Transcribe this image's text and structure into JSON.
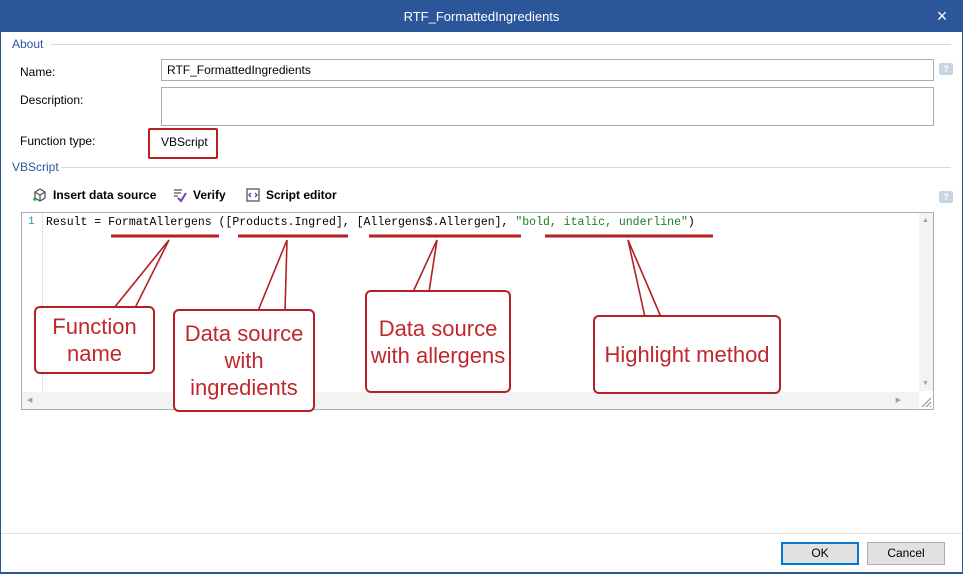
{
  "window": {
    "title": "RTF_FormattedIngredients",
    "close_icon": "×"
  },
  "about": {
    "section_label": "About",
    "name_label": "Name:",
    "name_value": "RTF_FormattedIngredients",
    "description_label": "Description:",
    "description_value": "",
    "function_type_label": "Function type:",
    "function_type_value": "VBScript"
  },
  "vbscript": {
    "section_label": "VBScript",
    "toolbar": {
      "insert_label": "Insert data source",
      "verify_label": "Verify",
      "editor_label": "Script editor"
    },
    "line_number": "1",
    "code": {
      "part1": "Result = ",
      "func": "FormatAllergens",
      "part2": " ([",
      "ds1": "Products.Ingred",
      "part3": "], [",
      "ds2": "Allergens$.Allergen",
      "part4": "], ",
      "str": "\"bold, italic, underline\"",
      "part5": ")"
    }
  },
  "callouts": {
    "function_name": "Function name",
    "ingredients": "Data source with ingredients",
    "allergens": "Data source with allergens",
    "highlight": "Highlight method"
  },
  "buttons": {
    "ok": "OK",
    "cancel": "Cancel"
  },
  "colors": {
    "accent": "#2b579a",
    "callout_red": "#b52025"
  }
}
